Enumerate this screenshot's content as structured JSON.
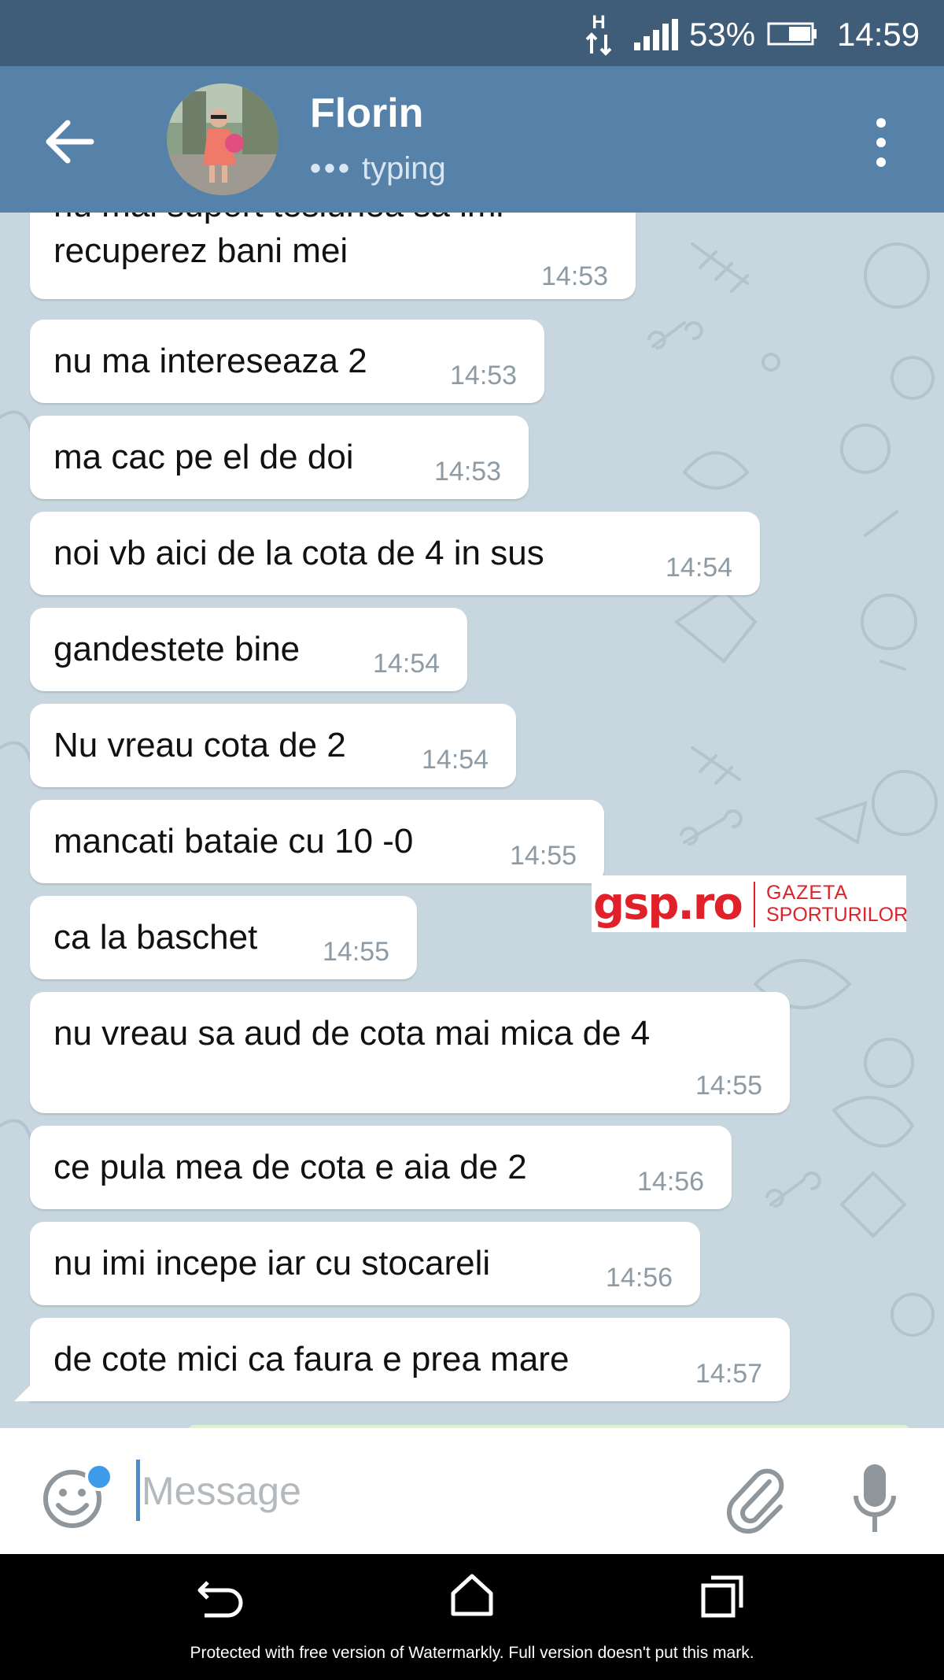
{
  "status_bar": {
    "network_type": "H",
    "battery_percent": "53%",
    "time": "14:59"
  },
  "header": {
    "contact_name": "Florin",
    "status_text": "typing",
    "status_dots": "•••"
  },
  "messages": [
    {
      "text": "nu mai suport tesiunea sa imi",
      "time": ""
    },
    {
      "text": "recuperez bani mei",
      "time": "14:53"
    },
    {
      "text": "nu ma intereseaza 2",
      "time": "14:53"
    },
    {
      "text": "ma cac pe el de doi",
      "time": "14:53"
    },
    {
      "text": "noi vb aici de la cota de 4 in sus",
      "time": "14:54"
    },
    {
      "text": "gandestete bine",
      "time": "14:54"
    },
    {
      "text": "Nu vreau cota de 2",
      "time": "14:54"
    },
    {
      "text": "mancati bataie cu 10 -0",
      "time": "14:55"
    },
    {
      "text": "ca la baschet",
      "time": "14:55"
    },
    {
      "text": "nu vreau sa aud de cota mai mica de 4",
      "time": "14:55"
    },
    {
      "text": "ce pula mea de cota e aia de 2",
      "time": "14:56"
    },
    {
      "text": "nu imi incepe iar cu stocareli",
      "time": "14:56"
    },
    {
      "text": "de cote mici ca faura e prea mare",
      "time": "14:57"
    }
  ],
  "input": {
    "placeholder": "Message"
  },
  "overlay_logo": {
    "brand": "gsp.ro",
    "line1": "GAZETA",
    "line2": "SPORTURILOR"
  },
  "watermark_note": "Protected with free version of Watermarkly. Full version doesn't put this mark.",
  "icons": {
    "back": "arrow-left-icon",
    "menu": "more-vertical-icon",
    "emoji": "smiley-icon",
    "attach": "paperclip-icon",
    "mic": "microphone-icon"
  },
  "colors": {
    "status_bar": "#3f5d78",
    "header": "#5681a8",
    "chat_bg": "#c8d6df",
    "bubble": "#ffffff",
    "time_text": "#8e9ba4",
    "caret": "#4a8cd0",
    "gsp_red": "#e1212a"
  }
}
